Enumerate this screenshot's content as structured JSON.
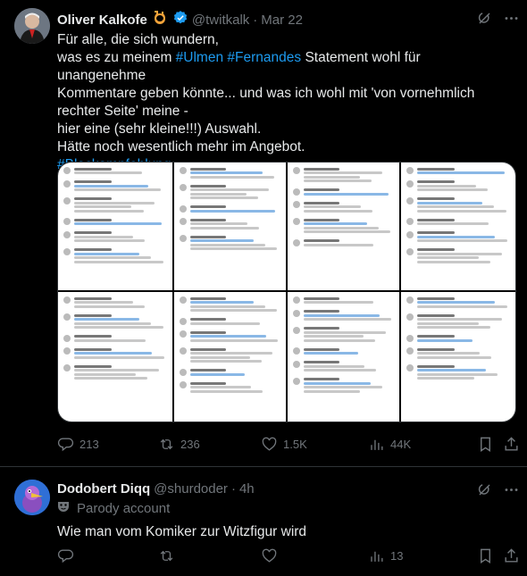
{
  "post1": {
    "author_name": "Oliver Kalkofe",
    "handle": "@twitkalk",
    "separator": "·",
    "date": "Mar 22",
    "text_lines": [
      "Für alle, die sich wundern,",
      "was es zu meinem #Ulmen #Fernandes Statement wohl für unangenehme",
      "Kommentare geben könnte... und was ich wohl mit 'von vornehmlich",
      "rechter Seite' meine -",
      "hier eine (sehr kleine!!!) Auswahl.",
      "Hätte noch wesentlich mehr im Angebot.",
      "#Blockempfehlung"
    ],
    "stats": {
      "replies": "213",
      "reposts": "236",
      "likes": "1.5K",
      "views": "44K"
    }
  },
  "post2": {
    "author_name": "Dodobert Diqq",
    "handle": "@shurdoder",
    "separator": "·",
    "time": "4h",
    "badge": "Parody account",
    "text": "Wie man vom Komiker zur Witzfigur wird",
    "stats": {
      "views": "13"
    }
  },
  "colors": {
    "background": "#000000",
    "text": "#e7e9ea",
    "muted": "#71767b",
    "link": "#1d9bf0",
    "verified": "#1d9bf0",
    "divider": "#2f3336"
  }
}
